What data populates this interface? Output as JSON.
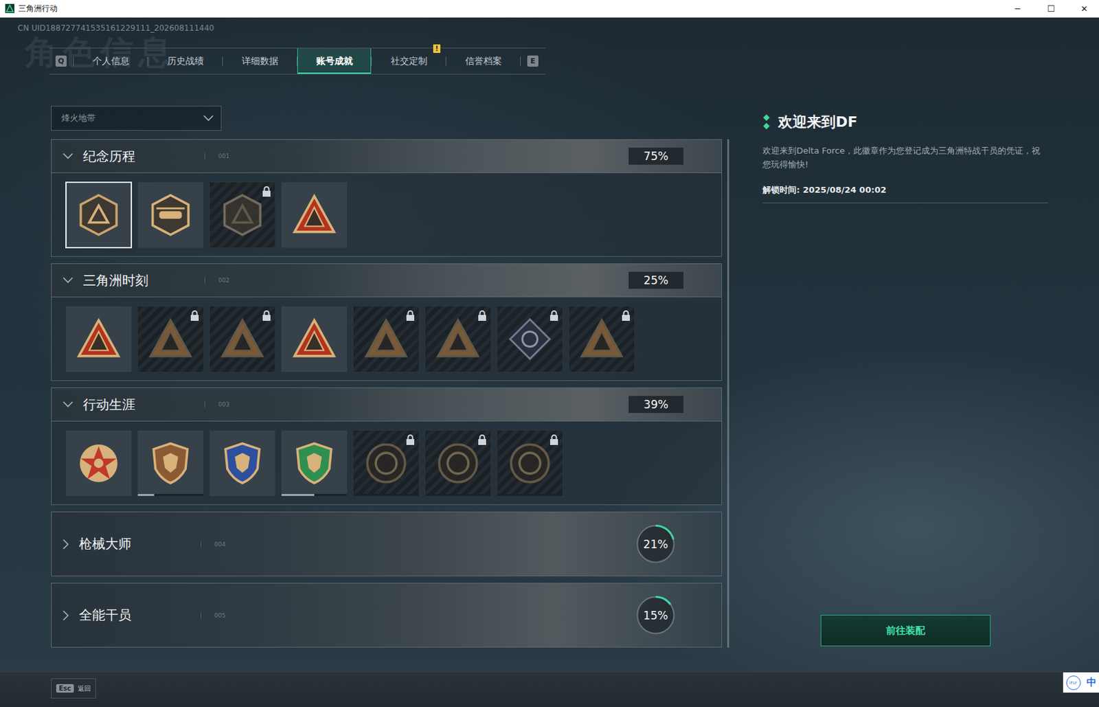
{
  "window": {
    "title": "三角洲行动",
    "controls": [
      "─",
      "☐",
      "✕"
    ]
  },
  "uid": "CN UID188727741535161229111_202608111440",
  "watermark": "角色信息",
  "tabs": {
    "prev_key": "Q",
    "next_key": "E",
    "items": [
      {
        "label": "个人信息",
        "selected": false
      },
      {
        "label": "历史战绩",
        "selected": false
      },
      {
        "label": "详细数据",
        "selected": false
      },
      {
        "label": "账号成就",
        "selected": true
      },
      {
        "label": "社交定制",
        "selected": false,
        "badge": "!"
      },
      {
        "label": "信誉档案",
        "selected": false
      }
    ]
  },
  "mode_select": {
    "value": "烽火地带"
  },
  "sections": [
    {
      "title": "纪念历程",
      "number": "001",
      "percent": "75%",
      "expanded": true,
      "badges": [
        {
          "locked": false,
          "selected": true
        },
        {
          "locked": false,
          "selected": false
        },
        {
          "locked": true,
          "selected": false
        },
        {
          "locked": false,
          "selected": false
        }
      ]
    },
    {
      "title": "三角洲时刻",
      "number": "002",
      "percent": "25%",
      "expanded": true,
      "badges": [
        {
          "locked": false,
          "selected": false
        },
        {
          "locked": true,
          "selected": false
        },
        {
          "locked": true,
          "selected": false
        },
        {
          "locked": false,
          "selected": false
        },
        {
          "locked": true,
          "selected": false
        },
        {
          "locked": true,
          "selected": false
        },
        {
          "locked": true,
          "selected": false
        },
        {
          "locked": true,
          "selected": false
        }
      ]
    },
    {
      "title": "行动生涯",
      "number": "003",
      "percent": "39%",
      "expanded": true,
      "badges": [
        {
          "locked": false,
          "selected": false
        },
        {
          "locked": false,
          "selected": false,
          "level": 0.25
        },
        {
          "locked": false,
          "selected": false
        },
        {
          "locked": false,
          "selected": false,
          "level": 0.5
        },
        {
          "locked": true,
          "selected": false,
          "level": 0
        },
        {
          "locked": true,
          "selected": false,
          "level": 0
        },
        {
          "locked": true,
          "selected": false,
          "level": 0
        }
      ]
    },
    {
      "title": "枪械大师",
      "number": "004",
      "percent": "21%",
      "expanded": false,
      "level": 0.21,
      "badges": []
    },
    {
      "title": "全能干员",
      "number": "005",
      "percent": "15%",
      "expanded": false,
      "level": 0.15,
      "badges": []
    }
  ],
  "detail": {
    "title": "欢迎来到DF",
    "description": "欢迎来到Delta Force，此徽章作为您登记成为三角洲特战干员的凭证，祝您玩得愉快!",
    "unlock_time": "解锁时间: 2025/08/24 00:02",
    "button": "前往装配"
  },
  "footer": {
    "back_key": "Esc",
    "back_label": "返回",
    "ime": {
      "logo": "iFLY",
      "mode": "中"
    }
  }
}
